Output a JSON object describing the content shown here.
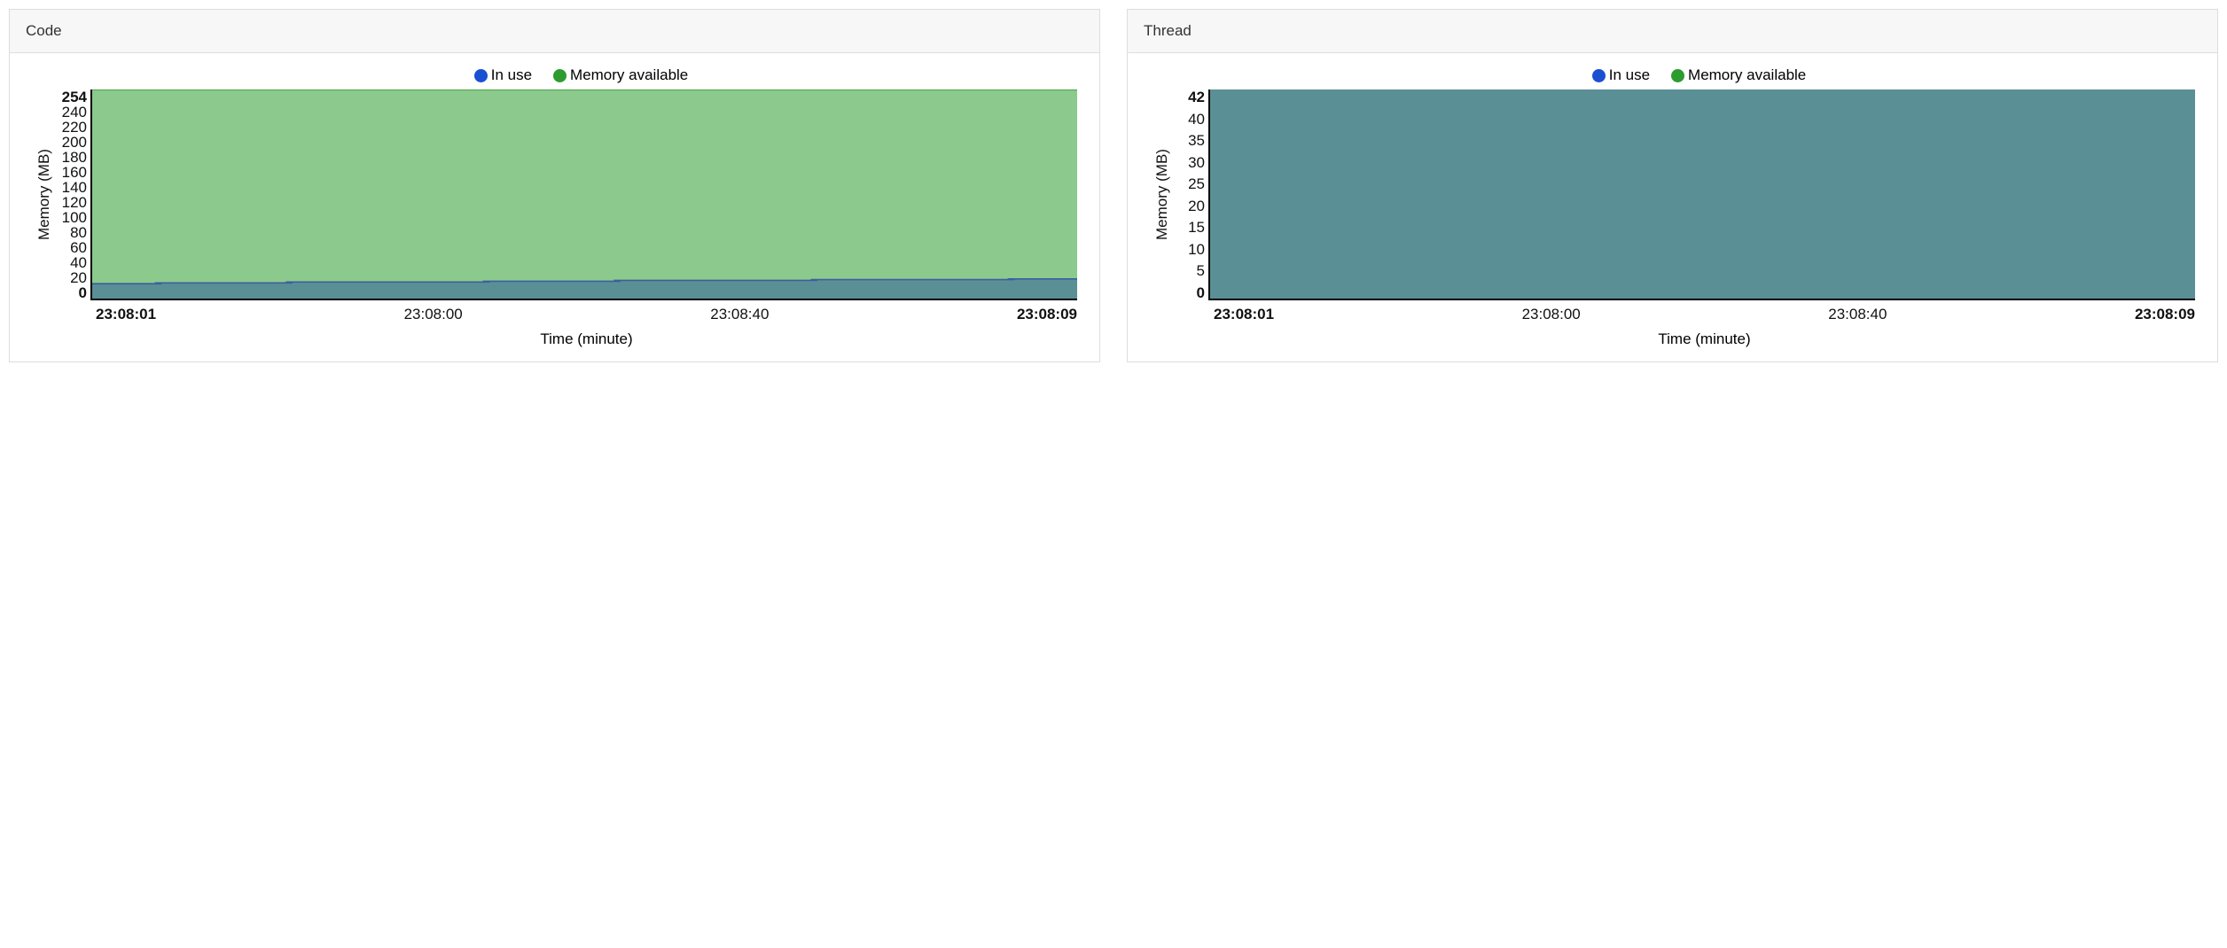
{
  "panels": [
    {
      "title": "Code"
    },
    {
      "title": "Thread"
    }
  ],
  "legend": {
    "in_use": {
      "label": "In use",
      "color": "#1a4fd1"
    },
    "available": {
      "label": "Memory available",
      "color": "#2e9b2e"
    }
  },
  "axes": {
    "ylabel": "Memory (MB)",
    "xlabel": "Time (minute)"
  },
  "colors": {
    "area_available": "#8cc98c",
    "area_inuse": "#5a8f96",
    "line_available": "#2e9b2e",
    "line_inuse": "#3b609e"
  },
  "chart_data": [
    {
      "type": "area",
      "title": "Code",
      "ylabel": "Memory (MB)",
      "xlabel": "Time (minute)",
      "ylim": [
        0,
        254
      ],
      "yticks": [
        0,
        20,
        40,
        60,
        80,
        100,
        120,
        140,
        160,
        180,
        200,
        220,
        240,
        254
      ],
      "x_categories": [
        "23:08:01",
        "23:08:00",
        "23:08:40",
        "23:08:09"
      ],
      "series": [
        {
          "name": "Memory available",
          "values": [
            254,
            254,
            254,
            254,
            254,
            254,
            254,
            254,
            254,
            254,
            254,
            254,
            254,
            254,
            254,
            254
          ]
        },
        {
          "name": "In use",
          "values": [
            18,
            19,
            19,
            20,
            20,
            20,
            21,
            21,
            22,
            22,
            22,
            23,
            23,
            23,
            24,
            24
          ]
        }
      ]
    },
    {
      "type": "area",
      "title": "Thread",
      "ylabel": "Memory (MB)",
      "xlabel": "Time (minute)",
      "ylim": [
        0,
        42
      ],
      "yticks": [
        0,
        5,
        10,
        15,
        20,
        25,
        30,
        35,
        40,
        42
      ],
      "x_categories": [
        "23:08:01",
        "23:08:00",
        "23:08:40",
        "23:08:09"
      ],
      "series": [
        {
          "name": "Memory available",
          "values": [
            42,
            42,
            42,
            42,
            42,
            42,
            42,
            42,
            42,
            42,
            42,
            42,
            42,
            42,
            42,
            42
          ]
        },
        {
          "name": "In use",
          "values": [
            42,
            42,
            42,
            42,
            42,
            42,
            42,
            42,
            42,
            42,
            42,
            42,
            42,
            42,
            42,
            42
          ]
        }
      ]
    }
  ]
}
